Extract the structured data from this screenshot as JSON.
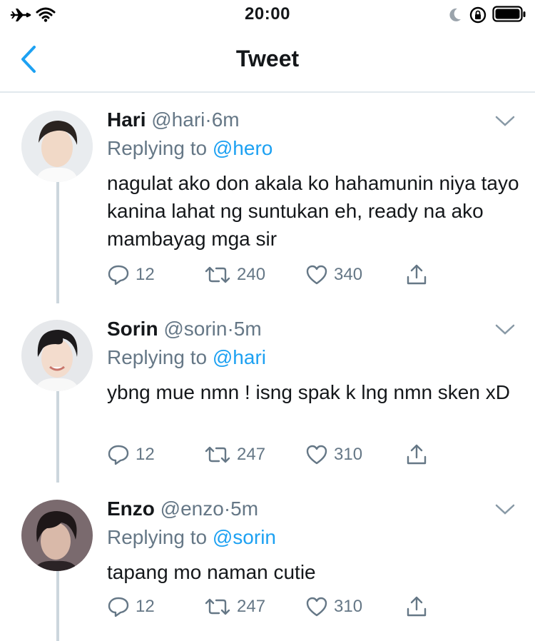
{
  "status_bar": {
    "time": "20:00"
  },
  "nav": {
    "title": "Tweet"
  },
  "tweets": [
    {
      "name": "Hari",
      "handle": "@hari",
      "sep": "·",
      "time": "6m",
      "replying_prefix": "Replying to",
      "replying_to": "@hero",
      "text": "nagulat ako don akala ko hahamunin niya tayo kanina lahat ng suntukan eh, ready na ako mambayag mga sir",
      "replies": "12",
      "retweets": "240",
      "likes": "340"
    },
    {
      "name": "Sorin",
      "handle": "@sorin",
      "sep": "·",
      "time": "5m",
      "replying_prefix": "Replying to",
      "replying_to": "@hari",
      "text": "ybng mue nmn ! isng spak k lng nmn sken xD",
      "replies": "12",
      "retweets": "247",
      "likes": "310"
    },
    {
      "name": "Enzo",
      "handle": "@enzo",
      "sep": "·",
      "time": "5m",
      "replying_prefix": "Replying to",
      "replying_to": "@sorin",
      "text": "tapang mo naman cutie",
      "replies": "12",
      "retweets": "247",
      "likes": "310"
    }
  ],
  "colors": {
    "link": "#1da1f2",
    "secondary": "#657786",
    "divider": "#e1e8ed",
    "thread": "#ccd6dd"
  }
}
